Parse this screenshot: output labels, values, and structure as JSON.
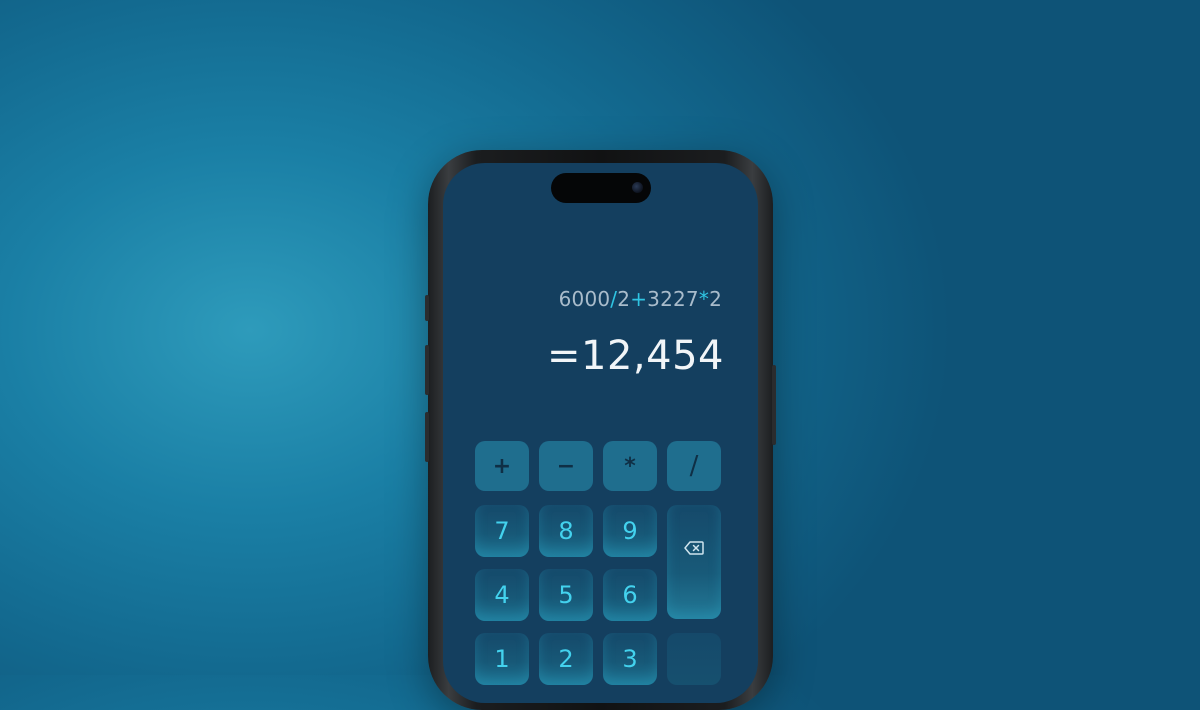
{
  "calculator": {
    "expression": [
      {
        "text": "6000",
        "type": "num"
      },
      {
        "text": "/",
        "type": "op"
      },
      {
        "text": "2",
        "type": "num"
      },
      {
        "text": "+",
        "type": "op"
      },
      {
        "text": "3227",
        "type": "num"
      },
      {
        "text": "*",
        "type": "op"
      },
      {
        "text": "2",
        "type": "num"
      }
    ],
    "result": "=12,454",
    "operators": [
      "+",
      "−",
      "*",
      "/"
    ],
    "digits": [
      "7",
      "8",
      "9",
      "4",
      "5",
      "6",
      "1",
      "2",
      "3"
    ],
    "backspace_icon": "backspace-icon"
  },
  "colors": {
    "accent": "#2fc4e2",
    "screen_bg": "#143f5f",
    "background": "#136a90"
  }
}
